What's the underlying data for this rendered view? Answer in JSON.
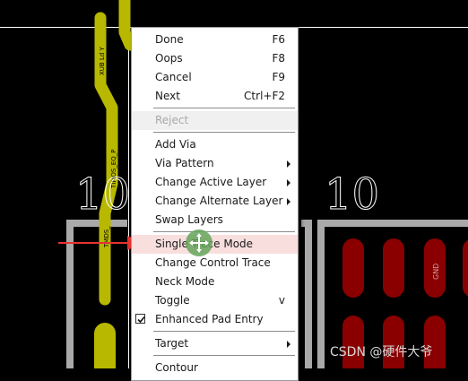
{
  "board": {
    "dimension_left": "10",
    "dimension_right": "10",
    "trace_labels": [
      "XUB Ld Y",
      "TIMOS_EQ_P",
      "TMDS_"
    ],
    "pad_net_gnd": "GND",
    "colors": {
      "background": "#000000",
      "trace": "#b8b800",
      "trace_text": "#000000",
      "outline": "#a9a9a9",
      "pad": "#8a0000",
      "crosshair": "#ffffff",
      "arrow": "#e8322f"
    }
  },
  "context_menu": {
    "items": [
      {
        "label": "Done",
        "shortcut": "F6"
      },
      {
        "label": "Oops",
        "shortcut": "F8"
      },
      {
        "label": "Cancel",
        "shortcut": "F9"
      },
      {
        "label": "Next",
        "shortcut": "Ctrl+F2"
      },
      {
        "label": "Reject",
        "disabled": true
      },
      {
        "label": "Add Via"
      },
      {
        "label": "Via Pattern",
        "submenu": true
      },
      {
        "label": "Change Active Layer",
        "submenu": true
      },
      {
        "label": "Change Alternate Layer",
        "submenu": true
      },
      {
        "label": "Swap Layers"
      },
      {
        "label": "Single Trace Mode",
        "highlighted": true
      },
      {
        "label": "Change Control Trace"
      },
      {
        "label": "Neck Mode"
      },
      {
        "label": "Toggle",
        "shortcut": "v"
      },
      {
        "label": "Enhanced Pad Entry",
        "checked": true
      },
      {
        "label": "Target",
        "submenu": true
      },
      {
        "label": "Contour"
      }
    ]
  },
  "cursor": {
    "icon": "move-crosshair-icon"
  },
  "watermark": "CSDN @硬件大爷"
}
